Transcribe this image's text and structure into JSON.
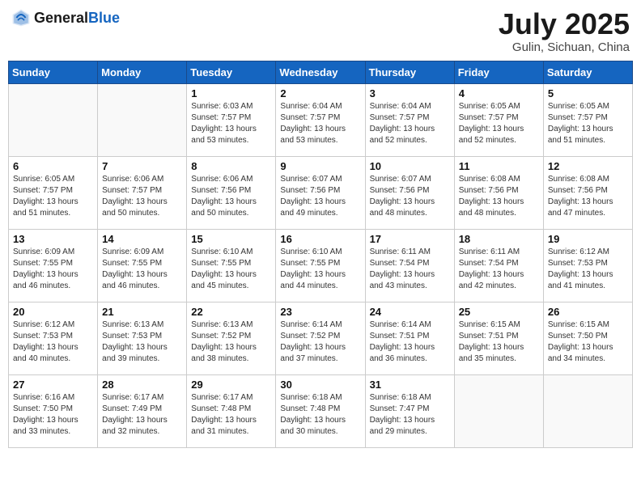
{
  "header": {
    "logo_general": "General",
    "logo_blue": "Blue",
    "month": "July 2025",
    "location": "Gulin, Sichuan, China"
  },
  "weekdays": [
    "Sunday",
    "Monday",
    "Tuesday",
    "Wednesday",
    "Thursday",
    "Friday",
    "Saturday"
  ],
  "weeks": [
    [
      {
        "day": "",
        "info": ""
      },
      {
        "day": "",
        "info": ""
      },
      {
        "day": "1",
        "info": "Sunrise: 6:03 AM\nSunset: 7:57 PM\nDaylight: 13 hours and 53 minutes."
      },
      {
        "day": "2",
        "info": "Sunrise: 6:04 AM\nSunset: 7:57 PM\nDaylight: 13 hours and 53 minutes."
      },
      {
        "day": "3",
        "info": "Sunrise: 6:04 AM\nSunset: 7:57 PM\nDaylight: 13 hours and 52 minutes."
      },
      {
        "day": "4",
        "info": "Sunrise: 6:05 AM\nSunset: 7:57 PM\nDaylight: 13 hours and 52 minutes."
      },
      {
        "day": "5",
        "info": "Sunrise: 6:05 AM\nSunset: 7:57 PM\nDaylight: 13 hours and 51 minutes."
      }
    ],
    [
      {
        "day": "6",
        "info": "Sunrise: 6:05 AM\nSunset: 7:57 PM\nDaylight: 13 hours and 51 minutes."
      },
      {
        "day": "7",
        "info": "Sunrise: 6:06 AM\nSunset: 7:57 PM\nDaylight: 13 hours and 50 minutes."
      },
      {
        "day": "8",
        "info": "Sunrise: 6:06 AM\nSunset: 7:56 PM\nDaylight: 13 hours and 50 minutes."
      },
      {
        "day": "9",
        "info": "Sunrise: 6:07 AM\nSunset: 7:56 PM\nDaylight: 13 hours and 49 minutes."
      },
      {
        "day": "10",
        "info": "Sunrise: 6:07 AM\nSunset: 7:56 PM\nDaylight: 13 hours and 48 minutes."
      },
      {
        "day": "11",
        "info": "Sunrise: 6:08 AM\nSunset: 7:56 PM\nDaylight: 13 hours and 48 minutes."
      },
      {
        "day": "12",
        "info": "Sunrise: 6:08 AM\nSunset: 7:56 PM\nDaylight: 13 hours and 47 minutes."
      }
    ],
    [
      {
        "day": "13",
        "info": "Sunrise: 6:09 AM\nSunset: 7:55 PM\nDaylight: 13 hours and 46 minutes."
      },
      {
        "day": "14",
        "info": "Sunrise: 6:09 AM\nSunset: 7:55 PM\nDaylight: 13 hours and 46 minutes."
      },
      {
        "day": "15",
        "info": "Sunrise: 6:10 AM\nSunset: 7:55 PM\nDaylight: 13 hours and 45 minutes."
      },
      {
        "day": "16",
        "info": "Sunrise: 6:10 AM\nSunset: 7:55 PM\nDaylight: 13 hours and 44 minutes."
      },
      {
        "day": "17",
        "info": "Sunrise: 6:11 AM\nSunset: 7:54 PM\nDaylight: 13 hours and 43 minutes."
      },
      {
        "day": "18",
        "info": "Sunrise: 6:11 AM\nSunset: 7:54 PM\nDaylight: 13 hours and 42 minutes."
      },
      {
        "day": "19",
        "info": "Sunrise: 6:12 AM\nSunset: 7:53 PM\nDaylight: 13 hours and 41 minutes."
      }
    ],
    [
      {
        "day": "20",
        "info": "Sunrise: 6:12 AM\nSunset: 7:53 PM\nDaylight: 13 hours and 40 minutes."
      },
      {
        "day": "21",
        "info": "Sunrise: 6:13 AM\nSunset: 7:53 PM\nDaylight: 13 hours and 39 minutes."
      },
      {
        "day": "22",
        "info": "Sunrise: 6:13 AM\nSunset: 7:52 PM\nDaylight: 13 hours and 38 minutes."
      },
      {
        "day": "23",
        "info": "Sunrise: 6:14 AM\nSunset: 7:52 PM\nDaylight: 13 hours and 37 minutes."
      },
      {
        "day": "24",
        "info": "Sunrise: 6:14 AM\nSunset: 7:51 PM\nDaylight: 13 hours and 36 minutes."
      },
      {
        "day": "25",
        "info": "Sunrise: 6:15 AM\nSunset: 7:51 PM\nDaylight: 13 hours and 35 minutes."
      },
      {
        "day": "26",
        "info": "Sunrise: 6:15 AM\nSunset: 7:50 PM\nDaylight: 13 hours and 34 minutes."
      }
    ],
    [
      {
        "day": "27",
        "info": "Sunrise: 6:16 AM\nSunset: 7:50 PM\nDaylight: 13 hours and 33 minutes."
      },
      {
        "day": "28",
        "info": "Sunrise: 6:17 AM\nSunset: 7:49 PM\nDaylight: 13 hours and 32 minutes."
      },
      {
        "day": "29",
        "info": "Sunrise: 6:17 AM\nSunset: 7:48 PM\nDaylight: 13 hours and 31 minutes."
      },
      {
        "day": "30",
        "info": "Sunrise: 6:18 AM\nSunset: 7:48 PM\nDaylight: 13 hours and 30 minutes."
      },
      {
        "day": "31",
        "info": "Sunrise: 6:18 AM\nSunset: 7:47 PM\nDaylight: 13 hours and 29 minutes."
      },
      {
        "day": "",
        "info": ""
      },
      {
        "day": "",
        "info": ""
      }
    ]
  ]
}
